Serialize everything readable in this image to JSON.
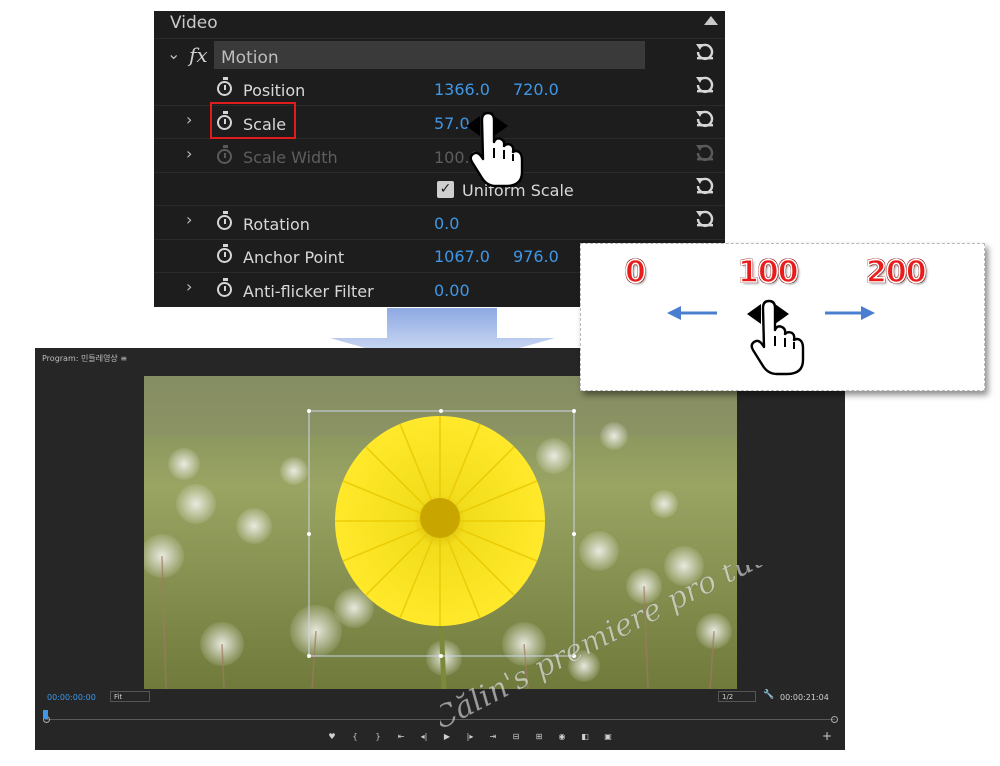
{
  "effect_controls": {
    "section_title": "Video",
    "effect_name": "Motion",
    "fx_badge": "fx",
    "properties": [
      {
        "label": "Position",
        "value1": "1366.0",
        "value2": "720.0"
      },
      {
        "label": "Scale",
        "value1": "57.0"
      },
      {
        "label": "Scale Width",
        "value1": "100.0"
      },
      {
        "label": "Rotation",
        "value1": "0.0"
      },
      {
        "label": "Anchor Point",
        "value1": "1067.0",
        "value2": "976.0"
      },
      {
        "label": "Anti-flicker Filter",
        "value1": "0.00"
      }
    ],
    "uniform_scale_label": "Uniform Scale",
    "uniform_scale_checked": true
  },
  "callout": {
    "min_label": "0",
    "mid_label": "100",
    "max_label": "200"
  },
  "program_monitor": {
    "title": "Program: 민들레영상",
    "menu_icon": "≡",
    "timecode_current": "00:00:00:00",
    "zoom_select": "Fit",
    "resolution_select": "1/2",
    "timecode_duration": "00:00:21:04",
    "transport_icons": [
      "marker-icon",
      "in-point-icon",
      "out-point-icon",
      "go-to-in-icon",
      "step-back-icon",
      "play-icon",
      "step-forward-icon",
      "go-to-out-icon",
      "lift-icon",
      "extract-icon",
      "export-frame-icon",
      "comparison-view-icon",
      "vr-icon"
    ]
  },
  "watermark": "Călin's premiere pro tutorials",
  "colors": {
    "panel_bg": "#1d1d1d",
    "value_blue": "#3f97e6",
    "highlight_red": "#e11c1c",
    "callout_red": "#ea1b1b",
    "arrow_blue": "#4a7fd0"
  }
}
